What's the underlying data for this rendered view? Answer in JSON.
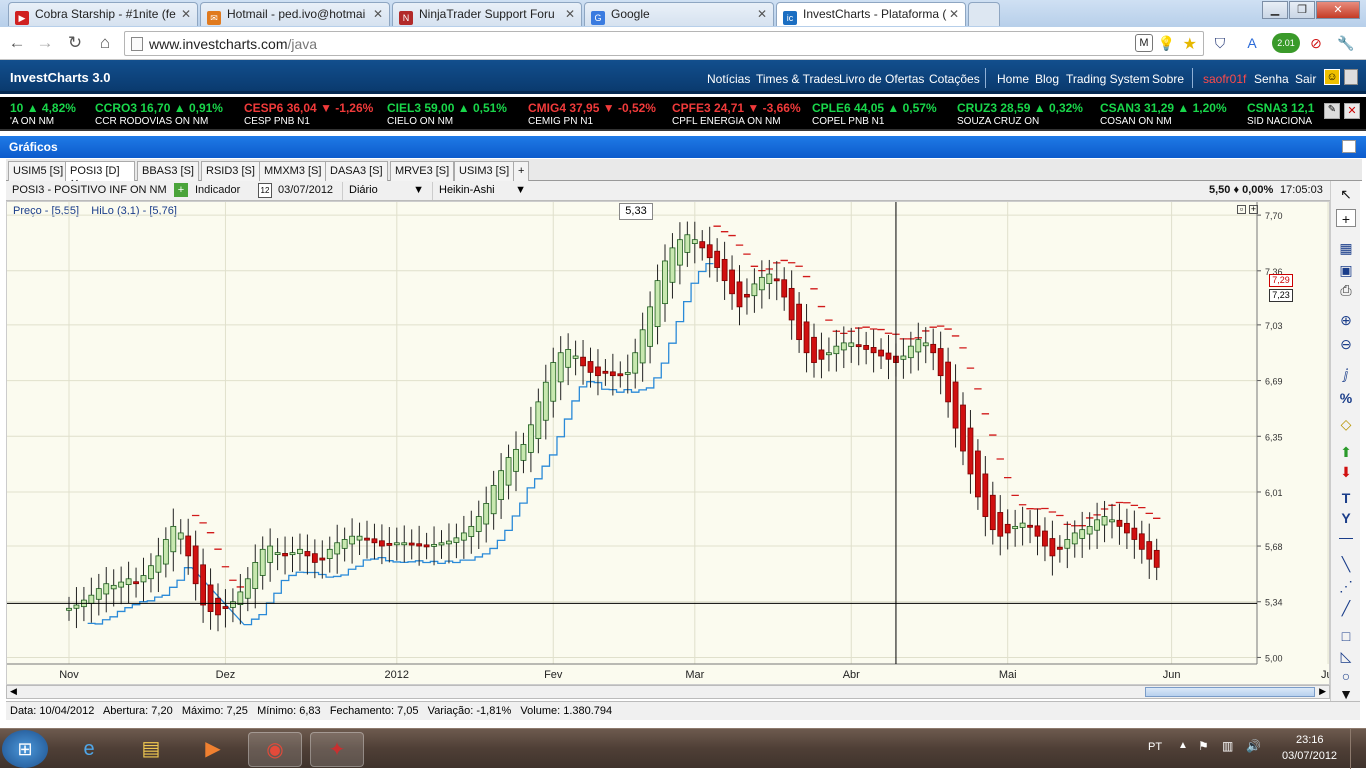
{
  "browser": {
    "tabs": [
      {
        "label": "Cobra Starship - #1nite (fe",
        "icon": "youtube-icon",
        "color": "#d02121"
      },
      {
        "label": "Hotmail - ped.ivo@hotmai",
        "icon": "hotmail-icon",
        "color": "#e07a1f"
      },
      {
        "label": "NinjaTrader Support Foru",
        "icon": "ninjatrader-icon",
        "color": "#b22a2a"
      },
      {
        "label": "Google",
        "icon": "google-icon",
        "color": "#3a7be0"
      },
      {
        "label": "InvestCharts - Plataforma (",
        "icon": "investcharts-icon",
        "color": "#1b6ec2"
      }
    ],
    "url_domain": "www.investcharts.com",
    "url_path": "/java",
    "ext_badge": "2.01"
  },
  "app": {
    "title": "InvestCharts 3.0",
    "menu": [
      "Notícias",
      "Times & Trades",
      "Livro de Ofertas",
      "Cotações"
    ],
    "menu2": [
      "Home",
      "Blog",
      "Trading System",
      "Sobre"
    ],
    "user": "saofr01f",
    "senha": "Senha",
    "sair": "Sair"
  },
  "ticker": [
    {
      "symbol": "10",
      "price": "",
      "change": "▲ 4,82%",
      "name": "'A ON NM",
      "dir": "up"
    },
    {
      "symbol": "CCRO3",
      "price": "16,70",
      "change": "▲ 0,91%",
      "name": "CCR RODOVIAS ON NM",
      "dir": "up"
    },
    {
      "symbol": "CESP6",
      "price": "36,04",
      "change": "▼ -1,26%",
      "name": "CESP PNB N1",
      "dir": "dn"
    },
    {
      "symbol": "CIEL3",
      "price": "59,00",
      "change": "▲ 0,51%",
      "name": "CIELO ON NM",
      "dir": "up"
    },
    {
      "symbol": "CMIG4",
      "price": "37,95",
      "change": "▼ -0,52%",
      "name": "CEMIG PN N1",
      "dir": "dn"
    },
    {
      "symbol": "CPFE3",
      "price": "24,71",
      "change": "▼ -3,66%",
      "name": "CPFL ENERGIA ON NM",
      "dir": "dn"
    },
    {
      "symbol": "CPLE6",
      "price": "44,05",
      "change": "▲ 0,57%",
      "name": "COPEL PNB N1",
      "dir": "up"
    },
    {
      "symbol": "CRUZ3",
      "price": "28,59",
      "change": "▲ 0,32%",
      "name": "SOUZA CRUZ ON",
      "dir": "up"
    },
    {
      "symbol": "CSAN3",
      "price": "31,29",
      "change": "▲ 1,20%",
      "name": "COSAN ON NM",
      "dir": "up"
    },
    {
      "symbol": "CSNA3",
      "price": "12,1",
      "change": "",
      "name": "SID NACIONA",
      "dir": "up"
    }
  ],
  "panel": {
    "title": "Gráficos"
  },
  "chart_tabs": [
    "USIM5 [S]",
    "POSI3 [D]",
    "BBAS3 [S]",
    "RSID3 [S]",
    "MMXM3 [S]",
    "DASA3 [S]",
    "MRVE3 [S]",
    "USIM3 [S]",
    "+"
  ],
  "toolbar": {
    "symbol": "POSI3 - POSITIVO INF ON NM",
    "indicator": "Indicador",
    "date": "03/07/2012",
    "date_icon_num": "12",
    "period": "Diário",
    "style": "Heikin-Ashi",
    "last": "5,50 ♦ 0,00%",
    "time": "17:05:03"
  },
  "legend": {
    "price": "Preço - [5,55]",
    "hilo": "HiLo (3,1) - [5,76]"
  },
  "cursor_label": "5,33",
  "price_tags": {
    "red": "7,29",
    "black": "7,23"
  },
  "chart_data": {
    "type": "candlestick",
    "style": "Heikin-Ashi",
    "y_ticks": [
      "7,70",
      "7,36",
      "7,03",
      "6,69",
      "6,35",
      "6,01",
      "5,68",
      "5,34",
      "5,00"
    ],
    "y_tick_values": [
      7.7,
      7.36,
      7.03,
      6.69,
      6.35,
      6.01,
      5.68,
      5.34,
      5.0
    ],
    "ylim": [
      4.96,
      7.78
    ],
    "x_ticks": [
      {
        "label": "Nov",
        "i": 0
      },
      {
        "label": "Dez",
        "i": 21
      },
      {
        "label": "2012",
        "i": 44
      },
      {
        "label": "Fev",
        "i": 65
      },
      {
        "label": "Mar",
        "i": 84
      },
      {
        "label": "Abr",
        "i": 105
      },
      {
        "label": "Mai",
        "i": 126
      },
      {
        "label": "Jun",
        "i": 148
      },
      {
        "label": "Jul",
        "i": 169
      }
    ],
    "closes": [
      5.3,
      5.32,
      5.35,
      5.38,
      5.42,
      5.45,
      5.44,
      5.46,
      5.48,
      5.46,
      5.5,
      5.56,
      5.62,
      5.72,
      5.8,
      5.76,
      5.62,
      5.45,
      5.32,
      5.28,
      5.26,
      5.3,
      5.34,
      5.4,
      5.48,
      5.58,
      5.66,
      5.68,
      5.64,
      5.62,
      5.64,
      5.66,
      5.62,
      5.58,
      5.6,
      5.66,
      5.7,
      5.72,
      5.74,
      5.74,
      5.72,
      5.7,
      5.68,
      5.69,
      5.7,
      5.7,
      5.69,
      5.68,
      5.68,
      5.69,
      5.7,
      5.71,
      5.73,
      5.76,
      5.8,
      5.86,
      5.94,
      6.05,
      6.14,
      6.22,
      6.27,
      6.3,
      6.42,
      6.56,
      6.68,
      6.8,
      6.86,
      6.88,
      6.84,
      6.78,
      6.74,
      6.72,
      6.74,
      6.72,
      6.73,
      6.74,
      6.86,
      7.0,
      7.14,
      7.3,
      7.42,
      7.5,
      7.55,
      7.58,
      7.55,
      7.5,
      7.44,
      7.38,
      7.3,
      7.22,
      7.14,
      7.2,
      7.28,
      7.32,
      7.34,
      7.3,
      7.2,
      7.06,
      6.94,
      6.86,
      6.8,
      6.82,
      6.86,
      6.9,
      6.92,
      6.92,
      6.9,
      6.88,
      6.86,
      6.84,
      6.82,
      6.8,
      6.84,
      6.9,
      6.94,
      6.92,
      6.86,
      6.72,
      6.56,
      6.4,
      6.26,
      6.12,
      5.98,
      5.86,
      5.78,
      5.74,
      5.76,
      5.8,
      5.82,
      5.8,
      5.74,
      5.68,
      5.62,
      5.66,
      5.72,
      5.76,
      5.78,
      5.8,
      5.84,
      5.86,
      5.84,
      5.8,
      5.76,
      5.72,
      5.66,
      5.6,
      5.55
    ],
    "hilo_color_red": "#d11a1a",
    "hilo_color_blue": "#2a8ad8",
    "up_color": "#c8e8b0",
    "down_color": "#d01010",
    "crosshair_price": 5.33,
    "crosshair_i": 111
  },
  "status": {
    "data": "Data: 10/04/2012",
    "abertura": "Abertura: 7,20",
    "maximo": "Máximo: 7,25",
    "minimo": "Mínimo: 6,83",
    "fechamento": "Fechamento: 7,05",
    "variacao": "Variação: -1,81%",
    "volume": "Volume: 1.380.794"
  },
  "taskbar": {
    "lang": "PT",
    "time": "23:16",
    "date": "03/07/2012"
  }
}
